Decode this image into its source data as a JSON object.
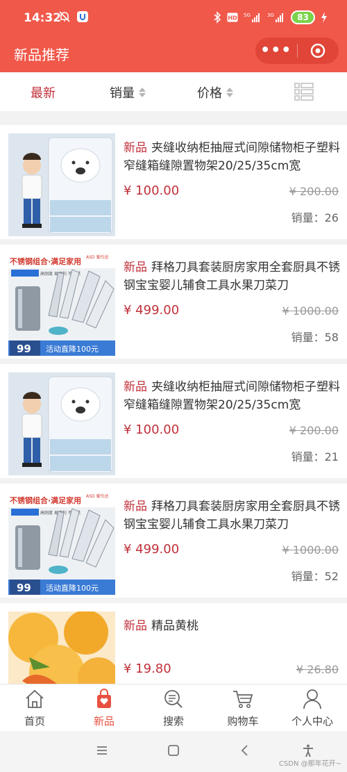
{
  "status": {
    "time": "14:32",
    "battery": "83"
  },
  "navbar": {
    "title": "新品推荐",
    "more_label": "•••"
  },
  "filters": [
    {
      "label": "最新",
      "active": true
    },
    {
      "label": "销量",
      "active": false
    },
    {
      "label": "价格",
      "active": false
    }
  ],
  "products": [
    {
      "tag": "新品",
      "name": "夹缝收纳柜抽屉式间隙储物柜子塑料窄缝箱缝隙置物架20/25/35cm宽",
      "price": "¥ 100.00",
      "original_price": "¥ 200.00",
      "sales": "销量：26",
      "image": "cabinet"
    },
    {
      "tag": "新品",
      "name": "拜格刀具套装厨房家用全套厨具不锈钢宝宝婴儿辅食工具水果刀菜刀",
      "price": "¥ 499.00",
      "original_price": "¥ 1000.00",
      "sales": "销量：58",
      "image": "knives"
    },
    {
      "tag": "新品",
      "name": "夹缝收纳柜抽屉式间隙储物柜子塑料窄缝箱缝隙置物架20/25/35cm宽",
      "price": "¥ 100.00",
      "original_price": "¥ 200.00",
      "sales": "销量：21",
      "image": "cabinet"
    },
    {
      "tag": "新品",
      "name": "拜格刀具套装厨房家用全套厨具不锈钢宝宝婴儿辅食工具水果刀菜刀",
      "price": "¥ 499.00",
      "original_price": "¥ 1000.00",
      "sales": "销量：52",
      "image": "knives"
    },
    {
      "tag": "新品",
      "name": "精品黄桃",
      "price": "¥ 19.80",
      "original_price": "¥ 26.80",
      "sales": "",
      "image": "peach"
    }
  ],
  "knife_banner": {
    "headline": "不锈钢组合·满足家用",
    "brand": "ASD 爱仕达",
    "badges": "高刚度 易磨利 不生锈",
    "price_tag": "99",
    "promo": "活动直降100元"
  },
  "tabbar": [
    {
      "label": "首页",
      "icon": "home-icon",
      "active": false
    },
    {
      "label": "新品",
      "icon": "bag-heart-icon",
      "active": true
    },
    {
      "label": "搜索",
      "icon": "search-icon",
      "active": false
    },
    {
      "label": "购物车",
      "icon": "cart-icon",
      "active": false
    },
    {
      "label": "个人中心",
      "icon": "user-icon",
      "active": false
    }
  ],
  "watermark": "CSDN @那年花开~",
  "colors": {
    "primary": "#f0584a",
    "price": "#c0303a",
    "tab_active": "#e8513f"
  }
}
